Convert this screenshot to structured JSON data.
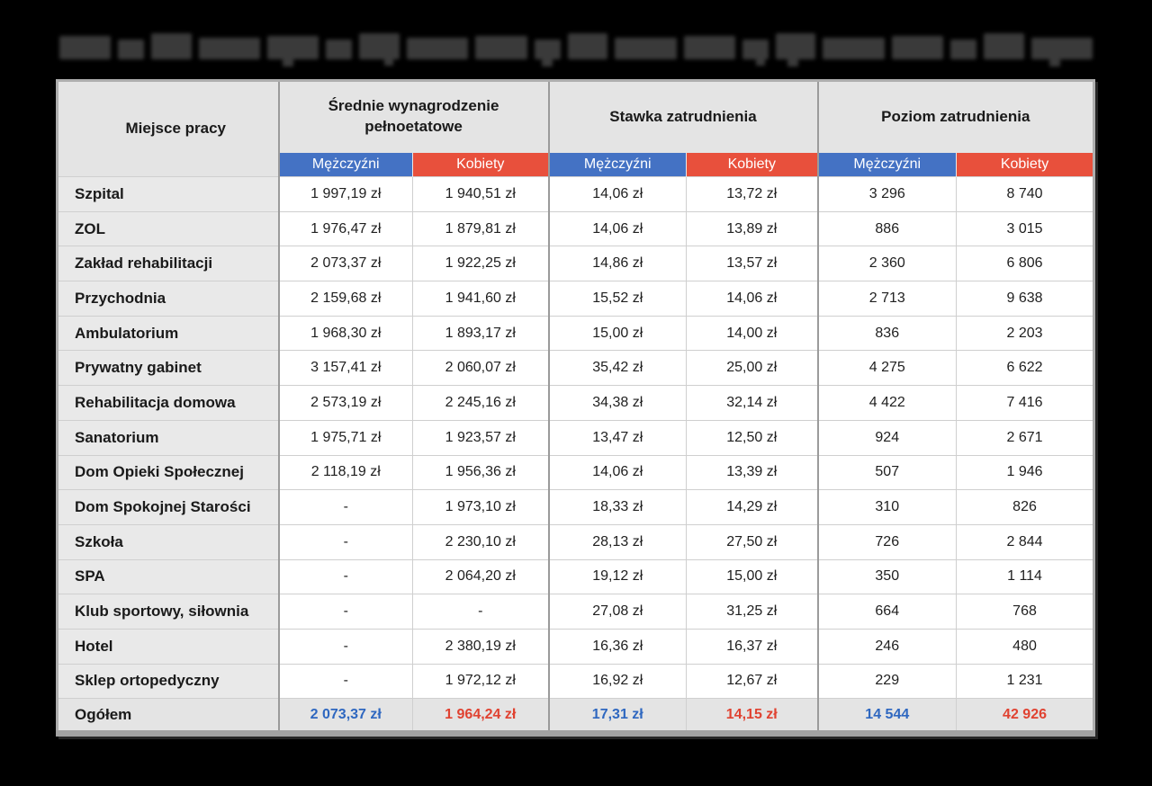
{
  "page_title": {
    "redacted": true,
    "note": "title line at top is pixelated/blurred and unreadable"
  },
  "colors": {
    "page_background": "#000000",
    "header_background": "#e4e4e4",
    "row_label_background": "#e9e9e9",
    "men_accent": "#4472C4",
    "women_accent": "#E8503C",
    "total_men_text": "#2E67C0",
    "total_women_text": "#E04231"
  },
  "chart_data": {
    "type": "table",
    "corner_header": "Miejsce pracy",
    "column_groups": [
      {
        "label": "Średnie wynagrodzenie pełnoetatowe",
        "sub": [
          "Mężczyźni",
          "Kobiety"
        ]
      },
      {
        "label": "Stawka zatrudnienia",
        "sub": [
          "Mężczyźni",
          "Kobiety"
        ]
      },
      {
        "label": "Poziom zatrudnienia",
        "sub": [
          "Mężczyźni",
          "Kobiety"
        ]
      }
    ],
    "rows": [
      {
        "label": "Szpital",
        "cells": [
          "1 997,19 zł",
          "1 940,51 zł",
          "14,06 zł",
          "13,72 zł",
          "3 296",
          "8 740"
        ]
      },
      {
        "label": "ZOL",
        "cells": [
          "1 976,47 zł",
          "1 879,81 zł",
          "14,06 zł",
          "13,89 zł",
          "886",
          "3 015"
        ]
      },
      {
        "label": "Zakład rehabilitacji",
        "cells": [
          "2 073,37 zł",
          "1 922,25 zł",
          "14,86 zł",
          "13,57 zł",
          "2 360",
          "6 806"
        ]
      },
      {
        "label": "Przychodnia",
        "cells": [
          "2 159,68 zł",
          "1 941,60 zł",
          "15,52 zł",
          "14,06 zł",
          "2 713",
          "9 638"
        ]
      },
      {
        "label": "Ambulatorium",
        "cells": [
          "1 968,30 zł",
          "1 893,17 zł",
          "15,00 zł",
          "14,00 zł",
          "836",
          "2 203"
        ]
      },
      {
        "label": "Prywatny gabinet",
        "cells": [
          "3 157,41 zł",
          "2 060,07 zł",
          "35,42 zł",
          "25,00 zł",
          "4 275",
          "6 622"
        ]
      },
      {
        "label": "Rehabilitacja domowa",
        "cells": [
          "2 573,19 zł",
          "2 245,16 zł",
          "34,38 zł",
          "32,14 zł",
          "4 422",
          "7 416"
        ]
      },
      {
        "label": "Sanatorium",
        "cells": [
          "1 975,71 zł",
          "1 923,57 zł",
          "13,47 zł",
          "12,50 zł",
          "924",
          "2 671"
        ]
      },
      {
        "label": "Dom Opieki Społecznej",
        "cells": [
          "2 118,19 zł",
          "1 956,36 zł",
          "14,06 zł",
          "13,39 zł",
          "507",
          "1 946"
        ]
      },
      {
        "label": "Dom Spokojnej Starości",
        "cells": [
          "-",
          "1 973,10 zł",
          "18,33 zł",
          "14,29 zł",
          "310",
          "826"
        ]
      },
      {
        "label": "Szkoła",
        "cells": [
          "-",
          "2 230,10 zł",
          "28,13 zł",
          "27,50 zł",
          "726",
          "2 844"
        ]
      },
      {
        "label": "SPA",
        "cells": [
          "-",
          "2 064,20 zł",
          "19,12 zł",
          "15,00 zł",
          "350",
          "1 114"
        ]
      },
      {
        "label": "Klub sportowy, siłownia",
        "cells": [
          "-",
          "-",
          "27,08 zł",
          "31,25 zł",
          "664",
          "768"
        ]
      },
      {
        "label": "Hotel",
        "cells": [
          "-",
          "2 380,19 zł",
          "16,36 zł",
          "16,37 zł",
          "246",
          "480"
        ]
      },
      {
        "label": "Sklep ortopedyczny",
        "cells": [
          "-",
          "1 972,12 zł",
          "16,92 zł",
          "12,67 zł",
          "229",
          "1 231"
        ]
      }
    ],
    "total_row": {
      "label": "Ogółem",
      "cells": [
        "2 073,37 zł",
        "1 964,24 zł",
        "17,31 zł",
        "14,15 zł",
        "14 544",
        "42 926"
      ]
    }
  }
}
